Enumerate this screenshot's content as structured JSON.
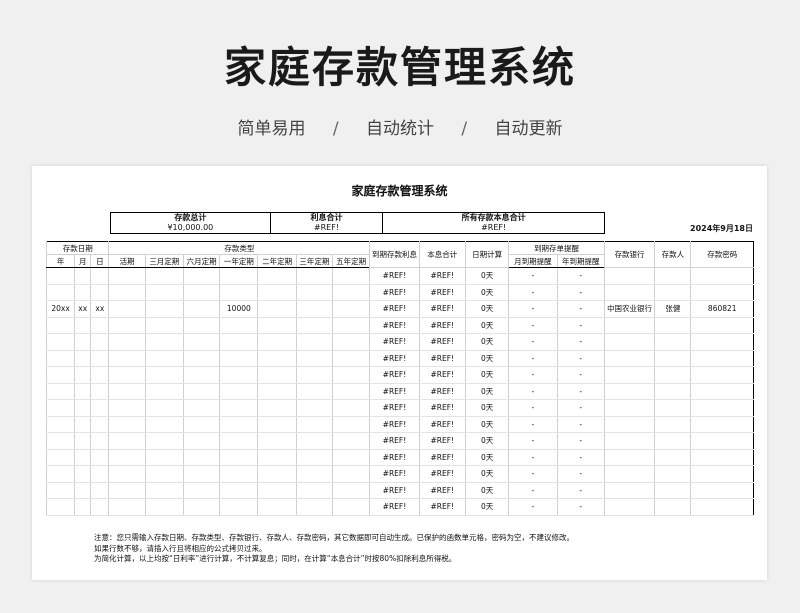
{
  "hero": {
    "title": "家庭存款管理系统",
    "tags": [
      "简单易用",
      "自动统计",
      "自动更新"
    ],
    "separator": "/"
  },
  "sheet": {
    "title": "家庭存款管理系统",
    "date": "2024年9月18日",
    "summary": {
      "headers": [
        "存款总计",
        "利息合计",
        "所有存款本息合计"
      ],
      "values": [
        "¥10,000.00",
        "#REF!",
        "#REF!"
      ]
    },
    "table": {
      "group_headers": {
        "date": "存款日期",
        "type": "存款类型",
        "reminder": "到期存单提醒"
      },
      "columns": [
        "年",
        "月",
        "日",
        "活期",
        "三月定期",
        "六月定期",
        "一年定期",
        "二年定期",
        "三年定期",
        "五年定期",
        "到期存款利息",
        "本息合计",
        "日期计算",
        "月到期提醒",
        "年到期提醒",
        "存款银行",
        "存款人",
        "存款密码"
      ],
      "rows": [
        [
          "",
          "",
          "",
          "",
          "",
          "",
          "",
          "",
          "",
          "",
          "#REF!",
          "#REF!",
          "0天",
          "-",
          "-",
          "",
          "",
          ""
        ],
        [
          "",
          "",
          "",
          "",
          "",
          "",
          "",
          "",
          "",
          "",
          "#REF!",
          "#REF!",
          "0天",
          "-",
          "-",
          "",
          "",
          ""
        ],
        [
          "20xx",
          "xx",
          "xx",
          "",
          "",
          "",
          "10000",
          "",
          "",
          "",
          "#REF!",
          "#REF!",
          "0天",
          "-",
          "-",
          "中国农业银行",
          "张健",
          "860821"
        ],
        [
          "",
          "",
          "",
          "",
          "",
          "",
          "",
          "",
          "",
          "",
          "#REF!",
          "#REF!",
          "0天",
          "-",
          "-",
          "",
          "",
          ""
        ],
        [
          "",
          "",
          "",
          "",
          "",
          "",
          "",
          "",
          "",
          "",
          "#REF!",
          "#REF!",
          "0天",
          "-",
          "-",
          "",
          "",
          ""
        ],
        [
          "",
          "",
          "",
          "",
          "",
          "",
          "",
          "",
          "",
          "",
          "#REF!",
          "#REF!",
          "0天",
          "-",
          "-",
          "",
          "",
          ""
        ],
        [
          "",
          "",
          "",
          "",
          "",
          "",
          "",
          "",
          "",
          "",
          "#REF!",
          "#REF!",
          "0天",
          "-",
          "-",
          "",
          "",
          ""
        ],
        [
          "",
          "",
          "",
          "",
          "",
          "",
          "",
          "",
          "",
          "",
          "#REF!",
          "#REF!",
          "0天",
          "-",
          "-",
          "",
          "",
          ""
        ],
        [
          "",
          "",
          "",
          "",
          "",
          "",
          "",
          "",
          "",
          "",
          "#REF!",
          "#REF!",
          "0天",
          "-",
          "-",
          "",
          "",
          ""
        ],
        [
          "",
          "",
          "",
          "",
          "",
          "",
          "",
          "",
          "",
          "",
          "#REF!",
          "#REF!",
          "0天",
          "-",
          "-",
          "",
          "",
          ""
        ],
        [
          "",
          "",
          "",
          "",
          "",
          "",
          "",
          "",
          "",
          "",
          "#REF!",
          "#REF!",
          "0天",
          "-",
          "-",
          "",
          "",
          ""
        ],
        [
          "",
          "",
          "",
          "",
          "",
          "",
          "",
          "",
          "",
          "",
          "#REF!",
          "#REF!",
          "0天",
          "-",
          "-",
          "",
          "",
          ""
        ],
        [
          "",
          "",
          "",
          "",
          "",
          "",
          "",
          "",
          "",
          "",
          "#REF!",
          "#REF!",
          "0天",
          "-",
          "-",
          "",
          "",
          ""
        ],
        [
          "",
          "",
          "",
          "",
          "",
          "",
          "",
          "",
          "",
          "",
          "#REF!",
          "#REF!",
          "0天",
          "-",
          "-",
          "",
          "",
          ""
        ],
        [
          "",
          "",
          "",
          "",
          "",
          "",
          "",
          "",
          "",
          "",
          "#REF!",
          "#REF!",
          "0天",
          "-",
          "-",
          "",
          "",
          ""
        ]
      ]
    },
    "notes": [
      "注意：您只需输入存款日期、存款类型、存款银行、存款人、存款密码，其它数据即可自动生成。已保护的函数单元格，密码为空，不建议修改。",
      "如果行数不够，请插入行且将相应的公式拷贝过来。",
      "为简化计算，以上均按“日利率”进行计算，不计算复息；同时，在计算“本息合计”时按80%扣除利息所得税。"
    ]
  }
}
